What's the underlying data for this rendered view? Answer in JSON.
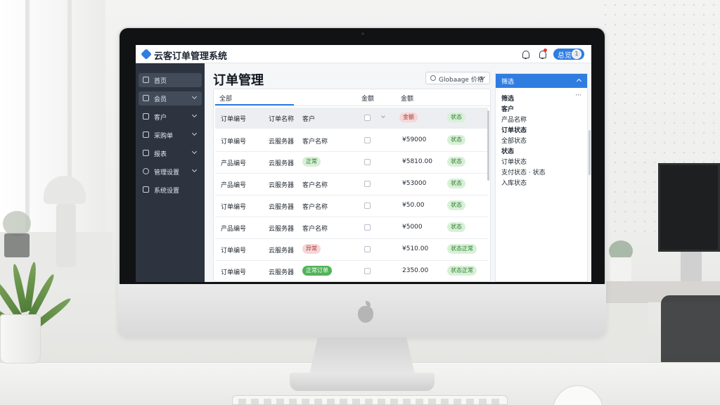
{
  "app": {
    "title": "云客订单管理系统",
    "user_label": "总览",
    "avatar_text": "1"
  },
  "sidebar": {
    "items": [
      {
        "label": "首页"
      },
      {
        "label": "会员"
      },
      {
        "label": "客户"
      },
      {
        "label": "采购单"
      },
      {
        "label": "报表"
      },
      {
        "label": "管理设置"
      },
      {
        "label": "系统设置"
      }
    ]
  },
  "main": {
    "page_title": "订单管理",
    "filter_value": "Globaage 价格"
  },
  "table": {
    "tabs": [
      "全部",
      "金额",
      "金额"
    ],
    "header": {
      "order": "订单编号",
      "product": "订单名称",
      "customer": "客户",
      "status": "金额",
      "tag": "状态"
    },
    "rows": [
      {
        "order": "订单编号",
        "product": "云服务器",
        "customer": "客户名称",
        "customer_pill": "",
        "customer_pill_color": "",
        "amount": "¥59000",
        "status": "状态"
      },
      {
        "order": "产品编号",
        "product": "云服务器",
        "customer": "",
        "customer_pill": "正常",
        "customer_pill_color": "green",
        "amount": "¥5810.00",
        "status": "状态"
      },
      {
        "order": "产品编号",
        "product": "云服务器",
        "customer": "客户名称",
        "customer_pill": "",
        "customer_pill_color": "",
        "amount": "¥53000",
        "status": "状态"
      },
      {
        "order": "订单编号",
        "product": "云服务器",
        "customer": "客户名称",
        "customer_pill": "",
        "customer_pill_color": "",
        "amount": "¥50.00",
        "status": "状态"
      },
      {
        "order": "产品编号",
        "product": "云服务器",
        "customer": "客户名称",
        "customer_pill": "",
        "customer_pill_color": "",
        "amount": "¥5000",
        "status": "状态"
      },
      {
        "order": "订单编号",
        "product": "云服务器",
        "customer": "",
        "customer_pill": "异常",
        "customer_pill_color": "red",
        "amount": "¥510.00",
        "status": "状态正常"
      },
      {
        "order": "订单编号",
        "product": "云服务器",
        "customer": "",
        "customer_pill": "正常订单",
        "customer_pill_color": "dark-green",
        "amount": "2350.00",
        "status": "状态正常"
      }
    ]
  },
  "panel": {
    "title": "筛选",
    "more": "···",
    "lines": [
      {
        "text": "筛选",
        "bold": true
      },
      {
        "text": "客户",
        "bold": true
      },
      {
        "text": "产品名称",
        "bold": false
      },
      {
        "text": "订单状态",
        "bold": true
      },
      {
        "text": "全部状态",
        "bold": false
      },
      {
        "text": "状态",
        "bold": true
      },
      {
        "text": "订单状态",
        "bold": false
      },
      {
        "text": "支付状态 · 状态",
        "bold": false
      },
      {
        "text": "入库状态",
        "bold": false
      }
    ]
  },
  "colors": {
    "accent": "#2f7de1",
    "sidebar": "#2d3440",
    "status_green": "#d8f0d7",
    "status_red": "#f6d6d6"
  }
}
